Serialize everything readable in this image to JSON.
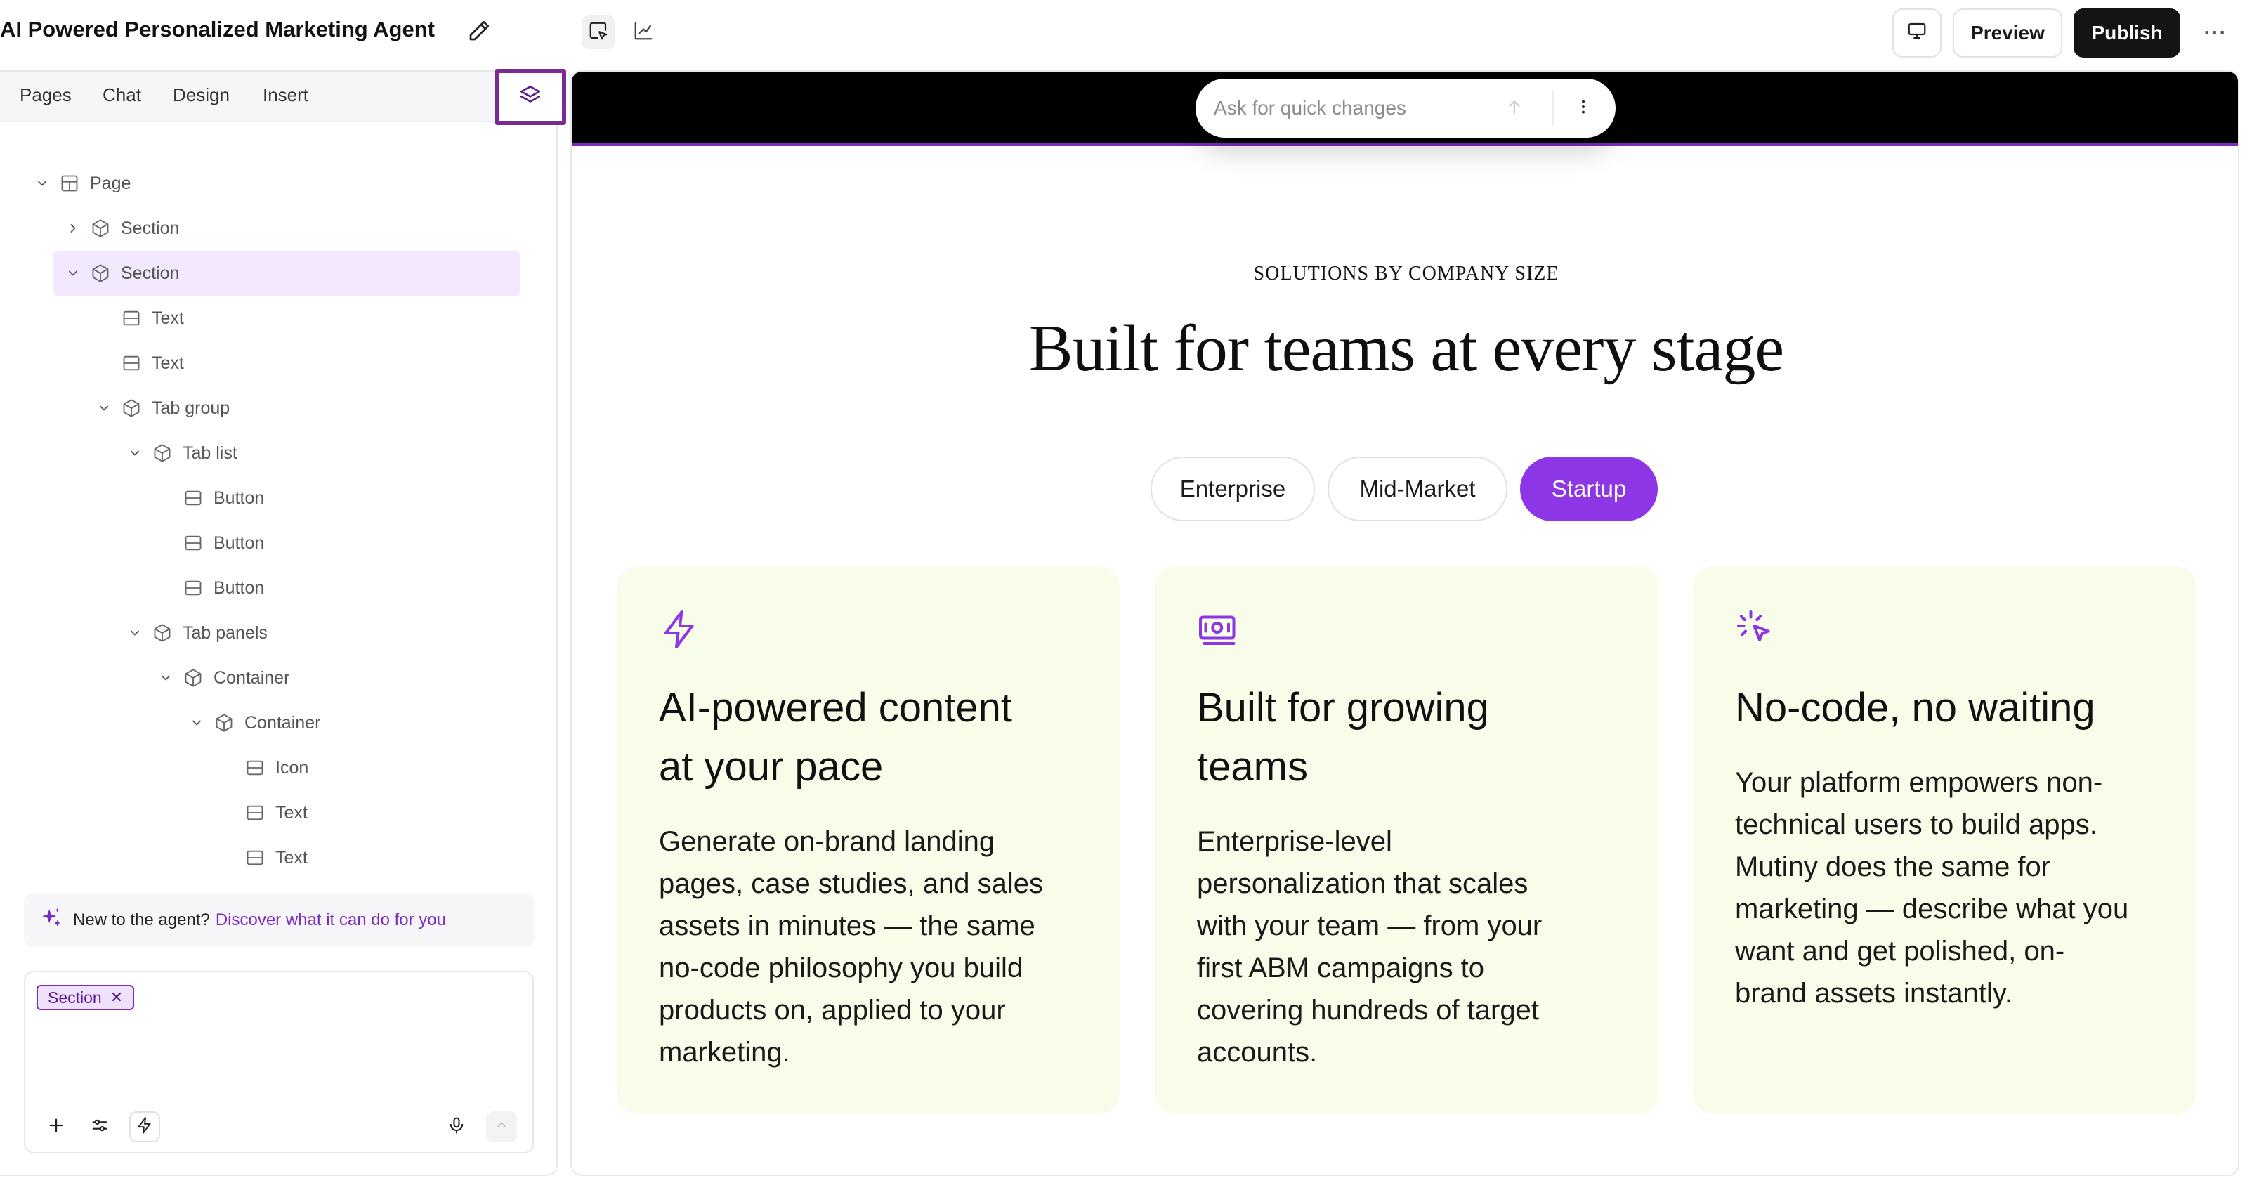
{
  "app": {
    "title": "AI Powered Personalized Marketing Agent"
  },
  "toolbar": {
    "preview_label": "Preview",
    "publish_label": "Publish",
    "more_label": "···"
  },
  "left_panel": {
    "tabs": [
      "Pages",
      "Chat",
      "Design",
      "Insert"
    ],
    "tree": [
      {
        "label": "Page",
        "depth": 0,
        "icon": "layout-icon",
        "chevron": "down"
      },
      {
        "label": "Section",
        "depth": 1,
        "icon": "cube-icon",
        "chevron": "right"
      },
      {
        "label": "Section",
        "depth": 1,
        "icon": "cube-icon",
        "chevron": "down",
        "selected": true
      },
      {
        "label": "Text",
        "depth": 2,
        "icon": "block-icon",
        "chevron": ""
      },
      {
        "label": "Text",
        "depth": 2,
        "icon": "block-icon",
        "chevron": ""
      },
      {
        "label": "Tab group",
        "depth": 2,
        "icon": "cube-icon",
        "chevron": "down"
      },
      {
        "label": "Tab list",
        "depth": 3,
        "icon": "cube-icon",
        "chevron": "down"
      },
      {
        "label": "Button",
        "depth": 4,
        "icon": "block-icon",
        "chevron": ""
      },
      {
        "label": "Button",
        "depth": 4,
        "icon": "block-icon",
        "chevron": ""
      },
      {
        "label": "Button",
        "depth": 4,
        "icon": "block-icon",
        "chevron": ""
      },
      {
        "label": "Tab panels",
        "depth": 3,
        "icon": "cube-icon",
        "chevron": "down"
      },
      {
        "label": "Container",
        "depth": 4,
        "icon": "cube-icon",
        "chevron": "down"
      },
      {
        "label": "Container",
        "depth": 5,
        "icon": "cube-icon",
        "chevron": "down"
      },
      {
        "label": "Icon",
        "depth": 6,
        "icon": "block-icon",
        "chevron": ""
      },
      {
        "label": "Text",
        "depth": 6,
        "icon": "block-icon",
        "chevron": ""
      },
      {
        "label": "Text",
        "depth": 6,
        "icon": "block-icon",
        "chevron": ""
      }
    ],
    "tip_prefix": "New to the agent?",
    "tip_link": "Discover what it can do for you",
    "chat_chip": "Section"
  },
  "canvas": {
    "ask_placeholder": "Ask for quick changes",
    "eyebrow": "SOLUTIONS BY COMPANY SIZE",
    "headline": "Built for teams at every stage",
    "tabs": [
      {
        "label": "Enterprise",
        "active": false
      },
      {
        "label": "Mid-Market",
        "active": false
      },
      {
        "label": "Startup",
        "active": true
      }
    ],
    "cards": [
      {
        "icon": "lightning-icon",
        "title_lines": [
          "AI-powered content",
          "at your pace"
        ],
        "body_lines": [
          "Generate on-brand landing",
          "pages, case studies, and sales",
          "assets in minutes — the same",
          "no-code philosophy you build",
          "products on, applied to your",
          "marketing."
        ]
      },
      {
        "icon": "money-icon",
        "title_lines": [
          "Built for growing",
          "teams"
        ],
        "body_lines": [
          "Enterprise-level",
          "personalization that scales",
          "with your team — from your",
          "first ABM campaigns to",
          "covering hundreds of target",
          "accounts."
        ]
      },
      {
        "icon": "cursor-click-icon",
        "title_lines": [
          "No-code, no waiting"
        ],
        "body_lines": [
          "Your platform empowers non-",
          "technical users to build apps.",
          "Mutiny does the same for",
          "marketing — describe what you",
          "want and get polished, on-",
          "brand assets instantly."
        ]
      }
    ]
  },
  "colors": {
    "accent": "#8c36e6",
    "selected_row": "#f3e8fd",
    "card_bg": "#f8fde9",
    "publish_bg": "#141414",
    "highlight_border": "#7a2b8f"
  }
}
